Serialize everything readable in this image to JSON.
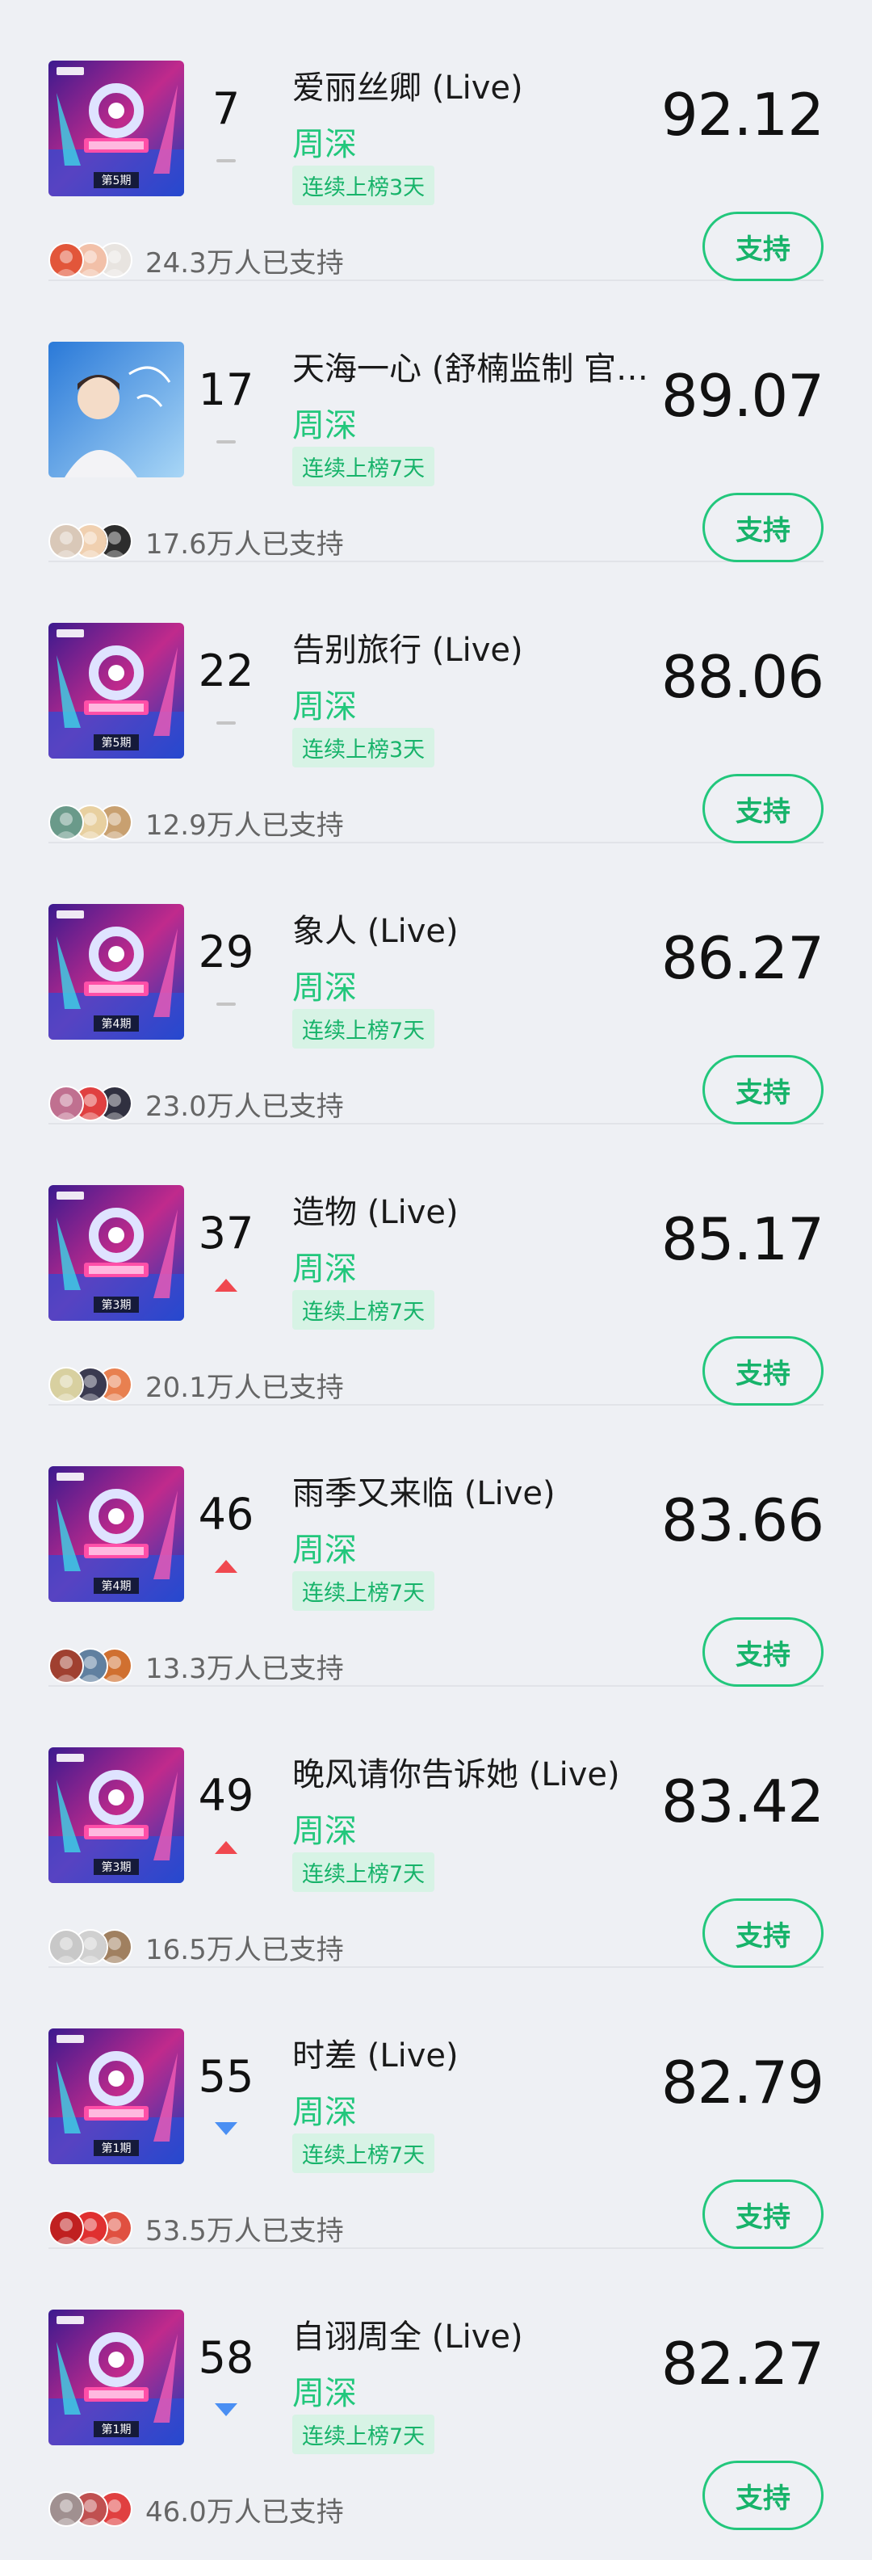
{
  "colors": {
    "accent": "#22c77c",
    "up": "#f0484f",
    "down": "#4a8ff3",
    "flat": "#c4c4c4"
  },
  "items": [
    {
      "rank": "7",
      "trend": "flat",
      "title": "爱丽丝卿 (Live)",
      "artist": "周深",
      "streak": "连续上榜3天",
      "score": "92.12",
      "support_label": "支持",
      "supporters": "24.3万人已支持",
      "cover": "variety",
      "episode": "第5期"
    },
    {
      "rank": "17",
      "trend": "flat",
      "title": "天海一心 (舒楠监制 官…",
      "artist": "周深",
      "streak": "连续上榜7天",
      "score": "89.07",
      "support_label": "支持",
      "supporters": "17.6万人已支持",
      "cover": "portrait",
      "episode": ""
    },
    {
      "rank": "22",
      "trend": "flat",
      "title": "告别旅行 (Live)",
      "artist": "周深",
      "streak": "连续上榜3天",
      "score": "88.06",
      "support_label": "支持",
      "supporters": "12.9万人已支持",
      "cover": "variety",
      "episode": "第5期"
    },
    {
      "rank": "29",
      "trend": "flat",
      "title": "象人 (Live)",
      "artist": "周深",
      "streak": "连续上榜7天",
      "score": "86.27",
      "support_label": "支持",
      "supporters": "23.0万人已支持",
      "cover": "variety",
      "episode": "第4期"
    },
    {
      "rank": "37",
      "trend": "up",
      "title": "造物 (Live)",
      "artist": "周深",
      "streak": "连续上榜7天",
      "score": "85.17",
      "support_label": "支持",
      "supporters": "20.1万人已支持",
      "cover": "variety",
      "episode": "第3期"
    },
    {
      "rank": "46",
      "trend": "up",
      "title": "雨季又来临 (Live)",
      "artist": "周深",
      "streak": "连续上榜7天",
      "score": "83.66",
      "support_label": "支持",
      "supporters": "13.3万人已支持",
      "cover": "variety",
      "episode": "第4期"
    },
    {
      "rank": "49",
      "trend": "up",
      "title": "晚风请你告诉她 (Live)",
      "artist": "周深",
      "streak": "连续上榜7天",
      "score": "83.42",
      "support_label": "支持",
      "supporters": "16.5万人已支持",
      "cover": "variety",
      "episode": "第3期"
    },
    {
      "rank": "55",
      "trend": "down",
      "title": "时差 (Live)",
      "artist": "周深",
      "streak": "连续上榜7天",
      "score": "82.79",
      "support_label": "支持",
      "supporters": "53.5万人已支持",
      "cover": "variety",
      "episode": "第1期"
    },
    {
      "rank": "58",
      "trend": "down",
      "title": "自诩周全 (Live)",
      "artist": "周深",
      "streak": "连续上榜7天",
      "score": "82.27",
      "support_label": "支持",
      "supporters": "46.0万人已支持",
      "cover": "variety",
      "episode": "第1期"
    }
  ]
}
